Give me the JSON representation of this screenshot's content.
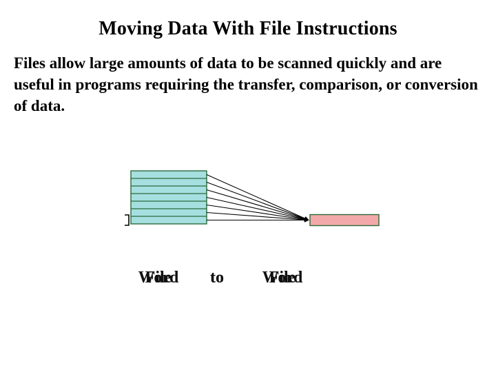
{
  "title": "Moving Data With File Instructions",
  "body": "Files allow large amounts of data to be scanned quickly and are useful in programs requiring the transfer, comparison, or conversion of data.",
  "rows": 7,
  "caption": {
    "col1_a": "File",
    "col1_b": "Word",
    "col2_a": "to",
    "col2_b": "to",
    "col3_a": "File",
    "col3_b": "Word"
  },
  "colors": {
    "src_fill": "#a6dfe0",
    "dest_fill": "#f3a9a9",
    "stroke": "#2a6a3a"
  }
}
